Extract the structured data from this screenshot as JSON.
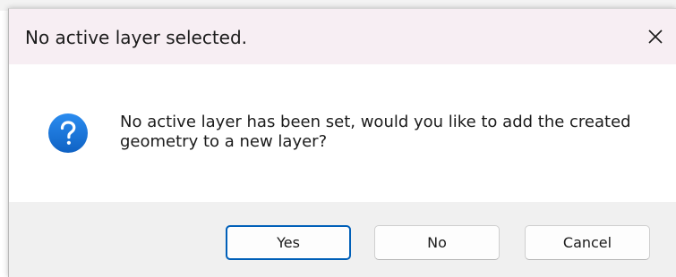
{
  "dialog": {
    "title": "No active layer selected.",
    "message": "No active layer has been set, would you like to add the created geometry to a new layer?",
    "icon": "question-icon",
    "buttons": {
      "yes": "Yes",
      "no": "No",
      "cancel": "Cancel"
    },
    "close_icon": "close-icon"
  },
  "colors": {
    "title_bar": "#f7eef3",
    "footer": "#f0f0f0",
    "accent": "#005fb8",
    "icon_blue": "#1a73d9"
  }
}
